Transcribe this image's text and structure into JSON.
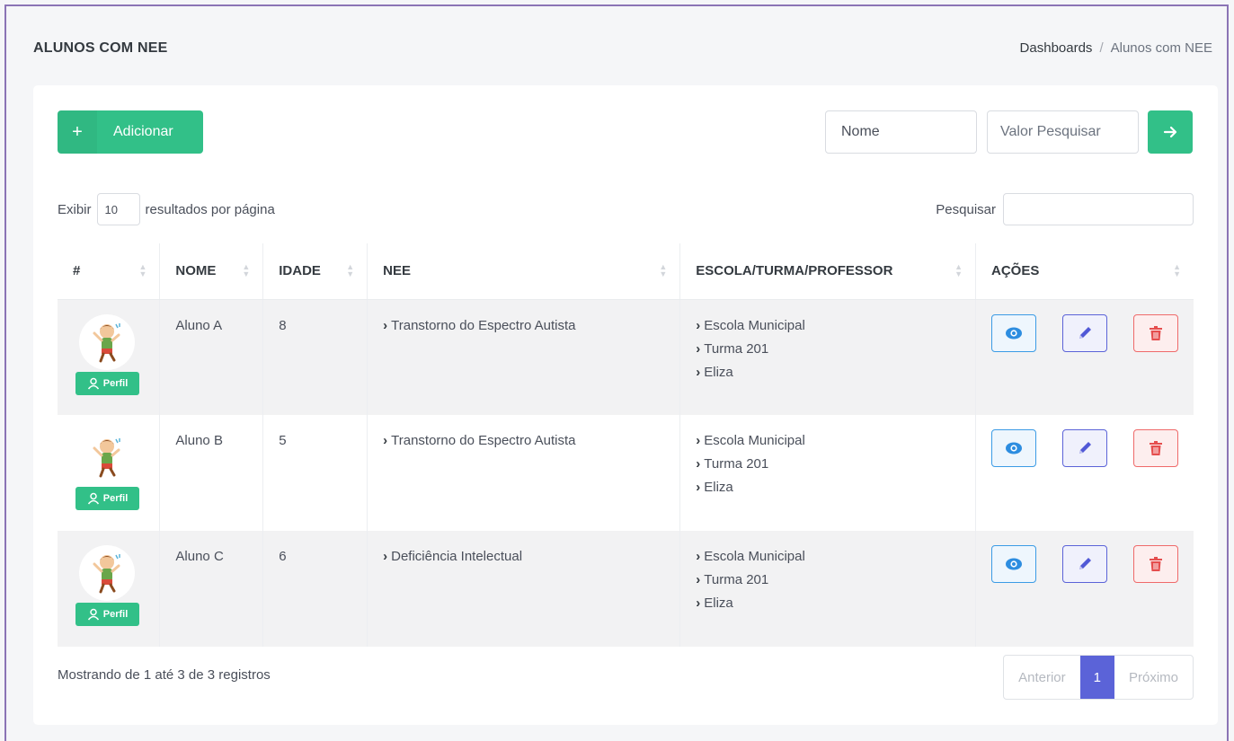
{
  "header": {
    "title": "ALUNOS COM NEE",
    "breadcrumb": [
      "Dashboards",
      "Alunos com NEE"
    ],
    "breadcrumb_sep": "/"
  },
  "toolbar": {
    "add_icon": "+",
    "add_label": "Adicionar",
    "field_select": "Nome",
    "value_placeholder": "Valor Pesquisar",
    "go_icon": "arrow-right-icon"
  },
  "table_controls": {
    "show_label": "Exibir",
    "page_length": "10",
    "per_page_label": "resultados por página",
    "search_label": "Pesquisar",
    "search_value": ""
  },
  "columns": [
    "#",
    "NOME",
    "IDADE",
    "NEE",
    "ESCOLA/TURMA/PROFESSOR",
    "AÇÕES"
  ],
  "rows": [
    {
      "name": "Aluno A",
      "age": "8",
      "nee": [
        "Transtorno do Espectro Autista"
      ],
      "school": [
        "Escola Municipal",
        "Turma 201",
        "Eliza"
      ],
      "profile_label": "Perfil"
    },
    {
      "name": "Aluno B",
      "age": "5",
      "nee": [
        "Transtorno do Espectro Autista"
      ],
      "school": [
        "Escola Municipal",
        "Turma 201",
        "Eliza"
      ],
      "profile_label": "Perfil"
    },
    {
      "name": "Aluno C",
      "age": "6",
      "nee": [
        "Deficiência Intelectual"
      ],
      "school": [
        "Escola Municipal",
        "Turma 201",
        "Eliza"
      ],
      "profile_label": "Perfil"
    }
  ],
  "footer": {
    "info": "Mostrando de 1 até 3 de 3 registros",
    "prev": "Anterior",
    "current_page": "1",
    "next": "Próximo"
  },
  "colors": {
    "primary_green": "#32c088",
    "view_blue": "#2d8de0",
    "edit_indigo": "#5159d6",
    "delete_red": "#e54e4e",
    "page_active": "#5b63d8"
  }
}
